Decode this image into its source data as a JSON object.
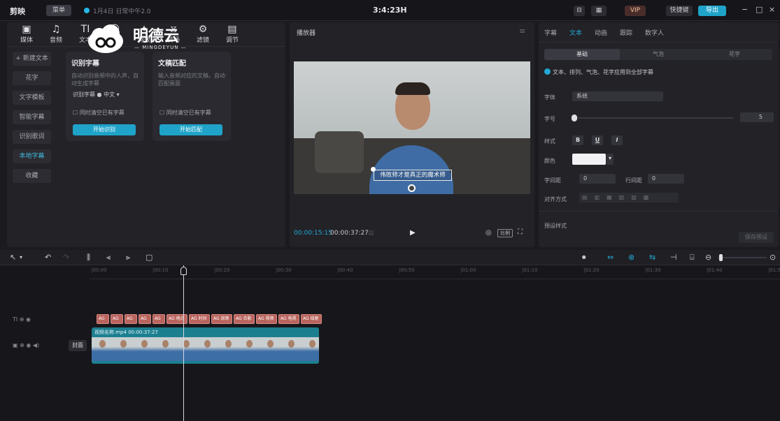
{
  "titlebar": {
    "logo": "剪映",
    "menu": "菜单",
    "project": "1月4日 日常中午2.0",
    "duration": "3:4:23H",
    "vip": "VIP",
    "btn_text": "快捷键",
    "btn_export": "导出",
    "win_min": "−",
    "win_max": "□",
    "win_close": "×"
  },
  "left_toolbar": [
    {
      "icon": "media-icon",
      "glyph": "▣",
      "label": "媒体"
    },
    {
      "icon": "audio-icon",
      "glyph": "♫",
      "label": "音频"
    },
    {
      "icon": "text-icon",
      "glyph": "TI",
      "label": "文本"
    },
    {
      "icon": "sticker-icon",
      "glyph": "☺",
      "label": "贴纸"
    },
    {
      "icon": "effects-icon",
      "glyph": "✦",
      "label": "特效"
    },
    {
      "icon": "transition-icon",
      "glyph": "⧖",
      "label": "转场"
    },
    {
      "icon": "filter-icon",
      "glyph": "⚙",
      "label": "滤镜"
    },
    {
      "icon": "adjust-icon",
      "glyph": "▤",
      "label": "调节"
    }
  ],
  "sidebar": {
    "items": [
      "+ 新建文本",
      "花字",
      "文字模板",
      "智能字幕",
      "识别歌词",
      "本地字幕",
      "收藏"
    ]
  },
  "cards": [
    {
      "title": "识别字幕",
      "desc": "自动识别音频中的人声，自动生成字幕",
      "lang": "识别字幕 ● 中文 ▾",
      "check": "同时清空已有字幕",
      "button": "开始识别"
    },
    {
      "title": "文稿匹配",
      "desc": "输入音频对应的文稿，自动匹配画面",
      "check": "同时清空已有字幕",
      "button": "开始匹配"
    }
  ],
  "watermark": {
    "brand": "明德云",
    "sub": "— MINGDEYUN —"
  },
  "player": {
    "title": "播放器",
    "subtitle": "伟败师才是真正的魔术师",
    "time_current": "00:00:15:15",
    "time_total": "00:00:37:27",
    "ratio": "比例",
    "menu": "≡"
  },
  "inspector": {
    "tabs": [
      "字幕",
      "文本",
      "动画",
      "跟踪",
      "数字人"
    ],
    "segments": [
      "基础",
      "气泡",
      "花字"
    ],
    "apply_all": "文本、排列、气泡、花字应用到全部字幕",
    "font_label": "字体",
    "font_value": "系统",
    "size_label": "字号",
    "size_value": "5",
    "style_label": "样式",
    "bold": "B",
    "underline": "U",
    "italic": "I",
    "color_label": "颜色",
    "spacing_label": "字间距",
    "spacing_value": "0",
    "line_label": "行间距",
    "line_value": "0",
    "align_label": "对齐方式",
    "preset_label": "预设样式",
    "save_preset": "保存预设"
  },
  "timeline": {
    "ticks": [
      "|00:00",
      "|00:10",
      "|00:20",
      "|00:30",
      "|00:40",
      "|00:50",
      "|01:00",
      "|01:10",
      "|01:20",
      "|01:30",
      "|01:40",
      "|01:50"
    ],
    "clip_name": "视频名称.mp4",
    "clip_duration": "00:00:37:27",
    "cover": "封面",
    "subtitle_clips": [
      "AG",
      "AG",
      "AG",
      "AG",
      "AG",
      "AG 地点",
      "AG 时间",
      "AG 放映",
      "AG 合影",
      "AG 视频",
      "AG 电视",
      "AG 结尾"
    ]
  }
}
